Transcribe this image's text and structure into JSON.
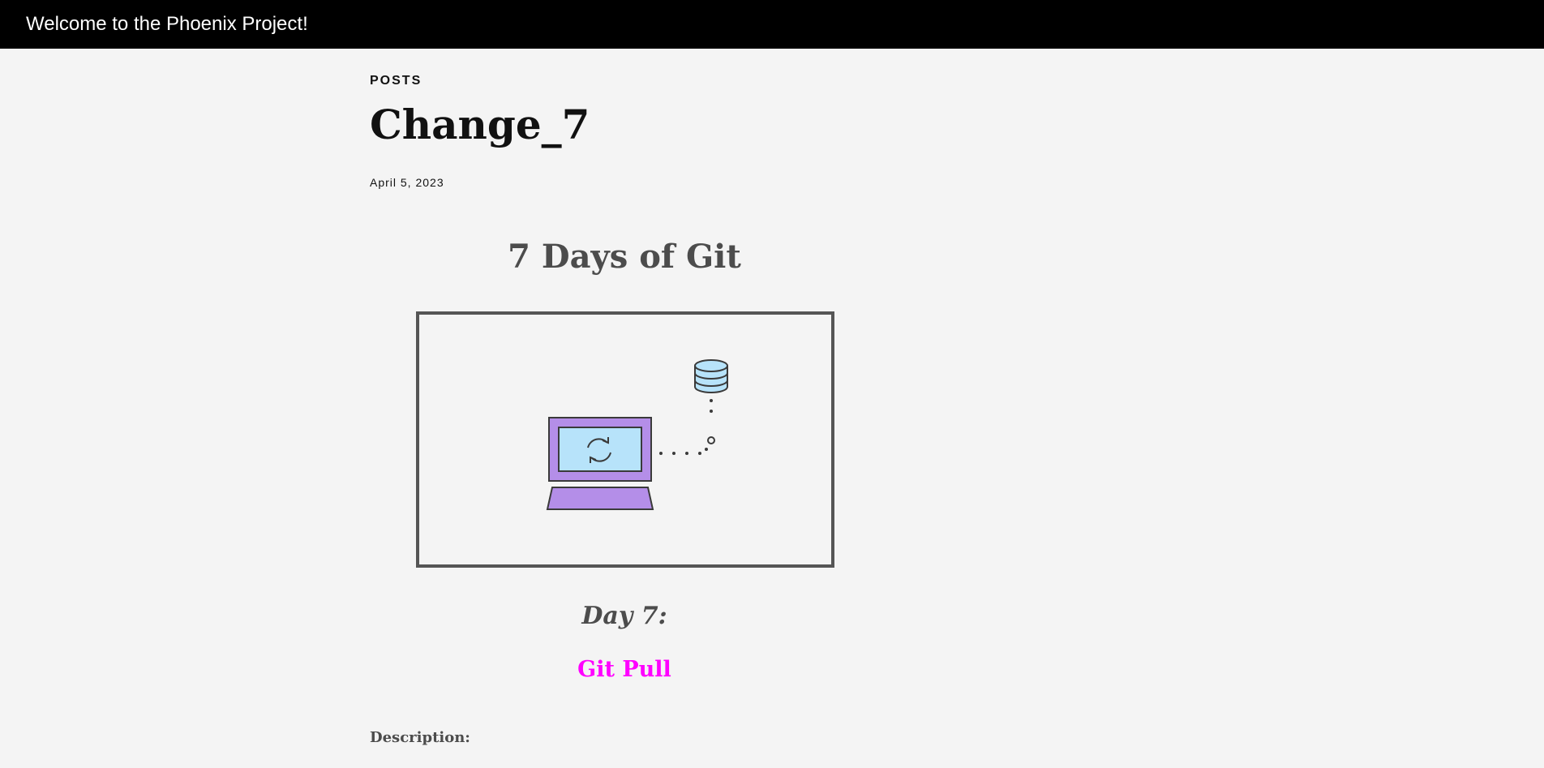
{
  "header": {
    "site_title": "Welcome to the Phoenix Project!"
  },
  "post": {
    "category": "POSTS",
    "title": "Change_7",
    "date": "April 5, 2023",
    "article_heading": "7 Days of Git",
    "day_label": "Day 7:",
    "command_label": "Git Pull",
    "description_label": "Description:"
  },
  "illustration": {
    "icons": [
      "laptop-icon",
      "sync-arrows-icon",
      "database-icon"
    ],
    "colors": {
      "laptop_body": "#b48ee8",
      "screen": "#b7e3fa",
      "database": "#b7e3fa",
      "outline": "#3a3a3a",
      "frame_border": "#555555"
    }
  },
  "colors": {
    "topbar_bg": "#000000",
    "page_bg": "#f4f4f4",
    "link": "#ff00ff",
    "heading_gray": "#4c4c4c"
  }
}
